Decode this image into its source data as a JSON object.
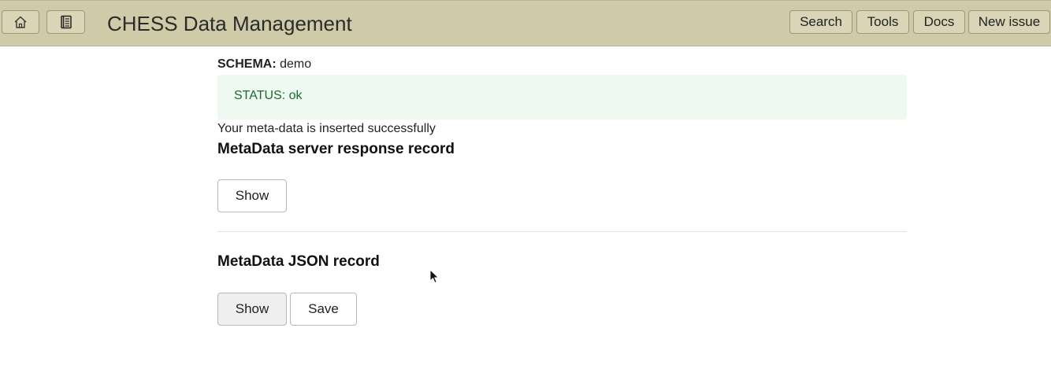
{
  "header": {
    "title": "CHESS Data Management",
    "home_icon": "home-icon",
    "docs_icon": "book-icon",
    "nav": {
      "search": "Search",
      "tools": "Tools",
      "docs": "Docs",
      "new_issue": "New issue"
    },
    "background": "#cfcaa8"
  },
  "main": {
    "schema_label": "SCHEMA:",
    "schema_value": "demo",
    "status": "STATUS: ok",
    "status_color": "#1d6b30",
    "message": "Your meta-data is inserted successfully",
    "response_section": {
      "heading": "MetaData server response record",
      "show_label": "Show"
    },
    "json_section": {
      "heading": "MetaData JSON record",
      "show_label": "Show",
      "save_label": "Save"
    }
  }
}
